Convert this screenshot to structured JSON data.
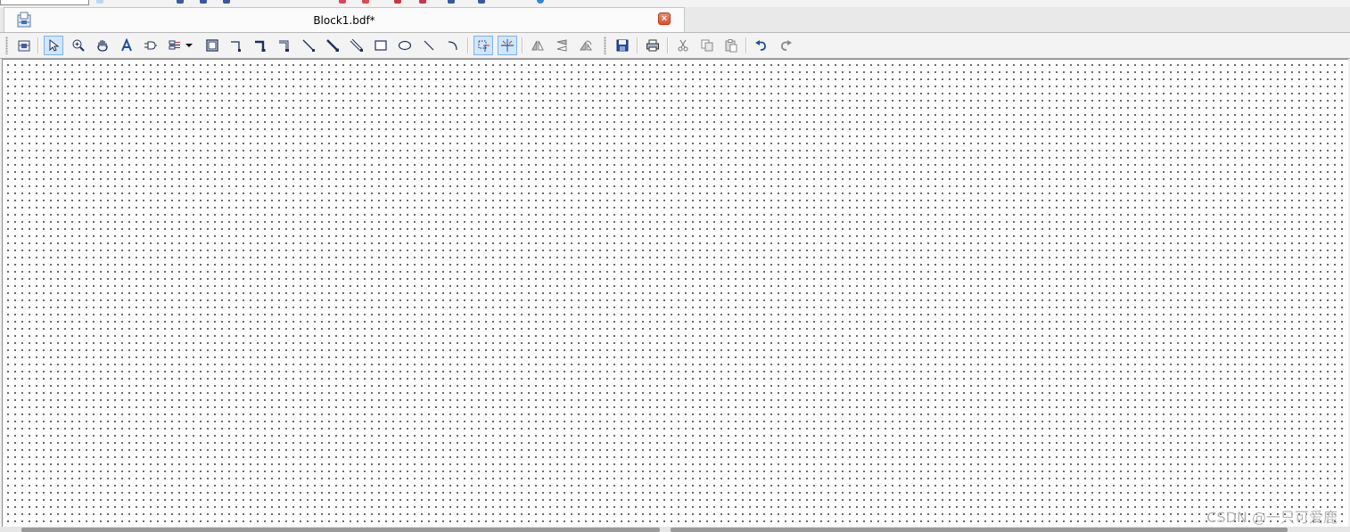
{
  "document_tab": {
    "title": "Block1.bdf*",
    "close_label": "×"
  },
  "toolbar": {
    "tools": [
      {
        "name": "block-diagram-icon",
        "active": false
      },
      {
        "name": "selection-tool-icon",
        "active": true
      },
      {
        "name": "zoom-tool-icon",
        "active": false
      },
      {
        "name": "hand-tool-icon",
        "active": false
      },
      {
        "name": "text-tool-icon",
        "active": false
      },
      {
        "name": "symbol-tool-icon",
        "active": false
      },
      {
        "name": "pin-tool-icon",
        "active": false
      },
      {
        "name": "block-tool-icon",
        "active": false
      },
      {
        "name": "orthogonal-node-tool-icon",
        "active": false
      },
      {
        "name": "orthogonal-bus-tool-icon",
        "active": false
      },
      {
        "name": "orthogonal-conduit-tool-icon",
        "active": false
      },
      {
        "name": "node-tool-icon",
        "active": false
      },
      {
        "name": "bus-tool-icon",
        "active": false
      },
      {
        "name": "conduit-tool-icon",
        "active": false
      },
      {
        "name": "rectangle-tool-icon",
        "active": false
      },
      {
        "name": "oval-tool-icon",
        "active": false
      },
      {
        "name": "line-tool-icon",
        "active": false
      },
      {
        "name": "arc-tool-icon",
        "active": false
      },
      {
        "name": "rubberbanding-icon",
        "active": true
      },
      {
        "name": "partial-line-selection-icon",
        "active": true
      },
      {
        "name": "flip-horizontal-icon",
        "active": false
      },
      {
        "name": "flip-vertical-icon",
        "active": false
      },
      {
        "name": "rotate-icon",
        "active": false
      },
      {
        "name": "save-icon",
        "active": false
      },
      {
        "name": "print-icon",
        "active": false
      },
      {
        "name": "cut-icon",
        "active": false
      },
      {
        "name": "copy-icon",
        "active": false
      },
      {
        "name": "paste-icon",
        "active": false
      },
      {
        "name": "undo-icon",
        "active": false
      },
      {
        "name": "redo-icon",
        "active": false
      }
    ]
  },
  "watermark": "CSDN @一只可爱鹿",
  "colors": {
    "accent_active": "#cfe6fb",
    "icon_blue": "#1f4f9c",
    "close_red": "#d9512d",
    "grid_dot": "#3a3a3a"
  }
}
